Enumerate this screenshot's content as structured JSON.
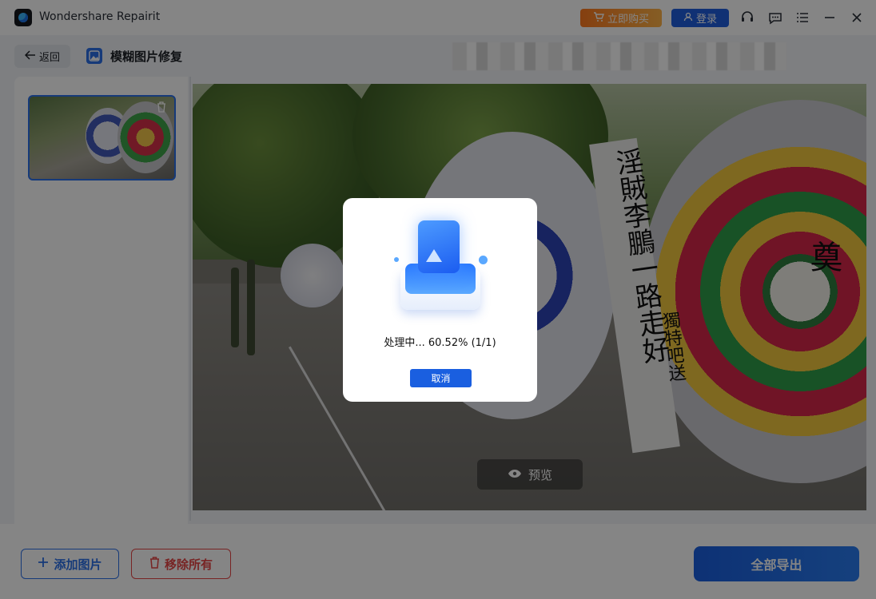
{
  "titlebar": {
    "app_name": "Wondershare Repairit",
    "buy_label": "立即购买",
    "login_label": "登录",
    "icons": [
      "headset-icon",
      "chat-icon",
      "menu-icon",
      "minimize-icon",
      "close-icon"
    ]
  },
  "subheader": {
    "back_label": "返回",
    "page_title": "模糊图片修复"
  },
  "preview": {
    "banner_text": "淫賊李鵬一路走好",
    "side_text": "獨特吧送",
    "wreath_char": "奠",
    "preview_label": "预览"
  },
  "bottombar": {
    "add_label": "添加图片",
    "remove_label": "移除所有",
    "export_label": "全部导出"
  },
  "modal": {
    "status_text": "处理中... 60.52% (1/1)",
    "progress_percent": 60.52,
    "cancel_label": "取消"
  },
  "colors": {
    "accent": "#1a5fe0",
    "danger": "#e64646",
    "buy": "#ff7a1f"
  }
}
